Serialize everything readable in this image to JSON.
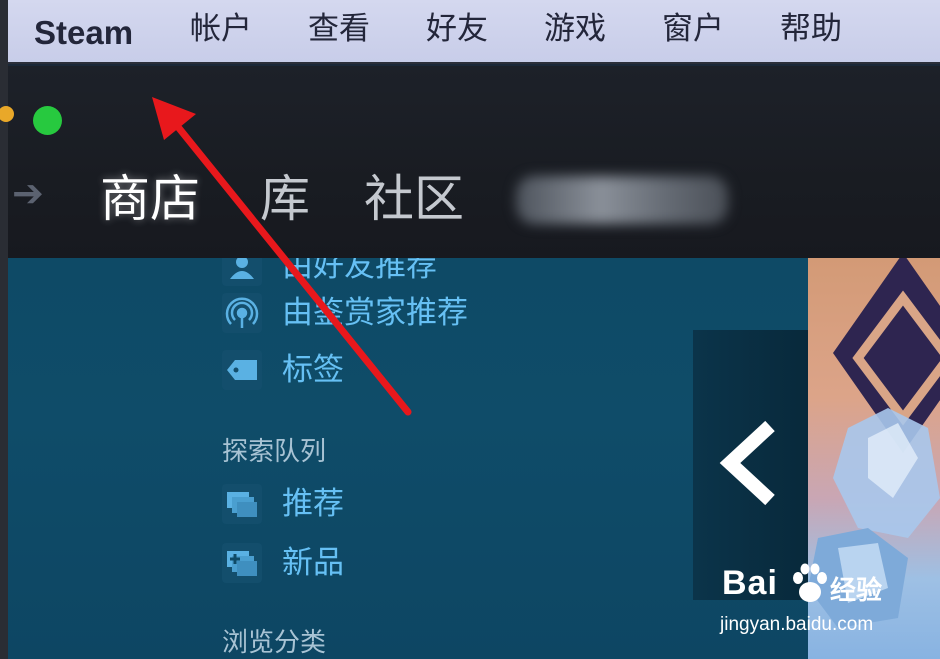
{
  "menubar": {
    "items": [
      "Steam",
      "帐户",
      "查看",
      "好友",
      "游戏",
      "窗户",
      "帮助"
    ]
  },
  "nav": {
    "tabs": [
      "商店",
      "库",
      "社区"
    ],
    "active_tab": "商店"
  },
  "store_menu": {
    "links": [
      {
        "label": "由好友推荐",
        "icon": "friends-icon"
      },
      {
        "label": "由鉴赏家推荐",
        "icon": "curator-broadcast-icon"
      },
      {
        "label": "标签",
        "icon": "tag-icon"
      }
    ],
    "discovery_heading": "探索队列",
    "discovery_links": [
      {
        "label": "推荐",
        "icon": "queue-icon"
      },
      {
        "label": "新品",
        "icon": "new-queue-icon"
      }
    ],
    "browse_heading": "浏览分类"
  },
  "carousel": {
    "prev_icon": "chevron-left-icon"
  },
  "watermark": {
    "brand": "Bai",
    "brand_suffix": "经验",
    "url": "jingyan.baidu.com"
  },
  "colors": {
    "menubar_bg": "#c8cde9",
    "link": "#66c0f4",
    "content_bg": "#0e4a66",
    "annotation": "#e8181c",
    "traffic_green": "#27c93f"
  }
}
